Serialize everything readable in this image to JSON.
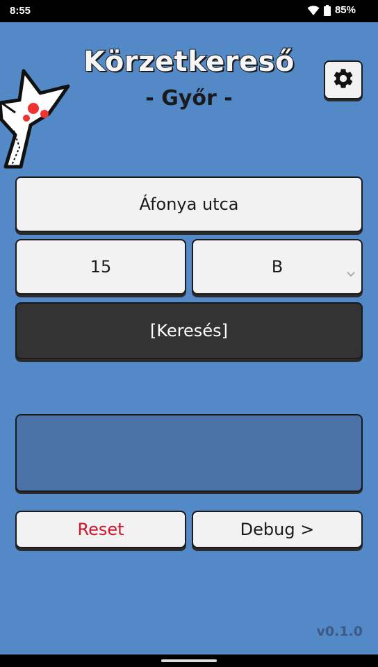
{
  "status_bar": {
    "time": "8:55",
    "battery": "85%",
    "icons": [
      "wifi-icon",
      "battery-icon"
    ]
  },
  "header": {
    "title": "Körzetkereső",
    "subtitle": "- Győr -",
    "settings_icon": "gear-icon"
  },
  "form": {
    "street_value": "Áfonya utca",
    "house_number_value": "15",
    "sub_letter_value": "B",
    "search_label": "[Keresés]"
  },
  "result": {
    "text": ""
  },
  "actions": {
    "reset_label": "Reset",
    "debug_label": "Debug >"
  },
  "footer": {
    "version": "v0.1.0"
  },
  "colors": {
    "background": "#5389c6",
    "button": "#f2f2f2",
    "search_button": "#333333",
    "result_panel": "#4a72a6",
    "reset_text": "#d0142a",
    "version_text": "#3a5a85"
  }
}
